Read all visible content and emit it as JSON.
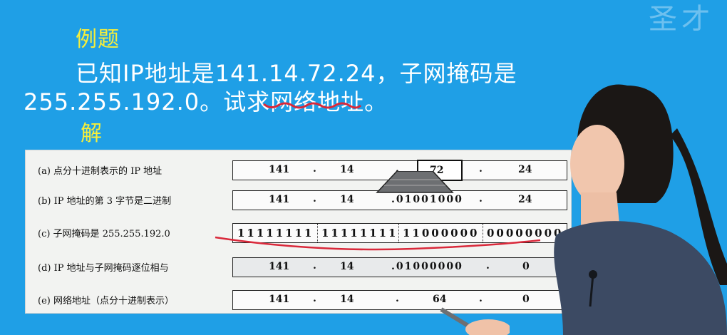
{
  "watermark": "圣才",
  "lesson": {
    "heading": "例题",
    "question_line1": "已知IP地址是141.14.72.24，子网掩码是",
    "question_line2": "255.255.192.0。试求网络地址。",
    "answer_heading": "解"
  },
  "table": {
    "rows": [
      {
        "label": "(a) 点分十进制表示的 IP 地址",
        "bytes": [
          "141",
          "14",
          "72",
          "24"
        ]
      },
      {
        "label": "(b) IP 地址的第 3 字节是二进制",
        "bytes": [
          "141",
          "14",
          ".01001000",
          "24"
        ]
      },
      {
        "label": "(c) 子网掩码是 255.255.192.0",
        "bytes": [
          "11111111",
          "11111111",
          "11000000",
          "00000000"
        ]
      },
      {
        "label": "(d) IP 地址与子网掩码逐位相与",
        "bytes": [
          "141",
          "14",
          ".01000000",
          "0"
        ]
      },
      {
        "label": "(e) 网络地址（点分十进制表示）",
        "bytes": [
          "141",
          "14",
          "64",
          "0"
        ]
      }
    ]
  },
  "colors": {
    "background": "#1f9fe6",
    "highlight_text": "#f7ee3a",
    "annotation_red": "#d9283a"
  }
}
